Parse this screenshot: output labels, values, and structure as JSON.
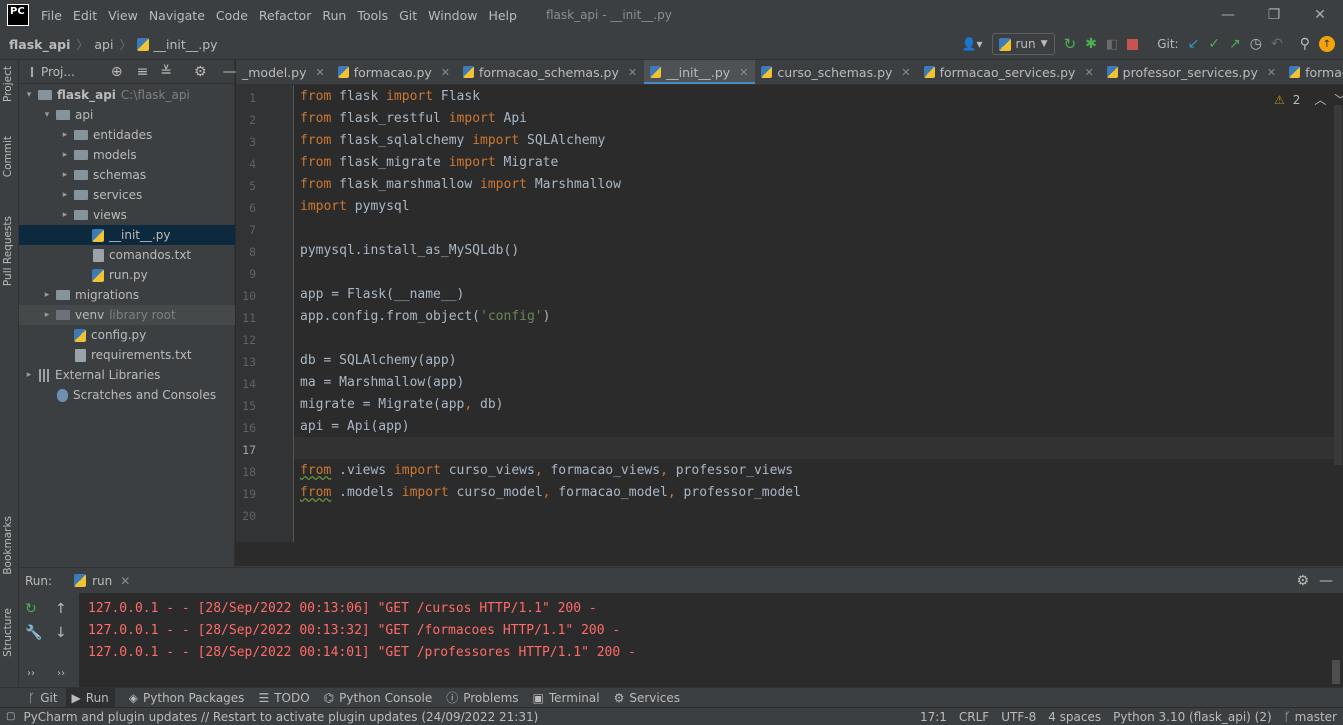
{
  "app": {
    "logo": "PC",
    "window_title": "flask_api - __init__.py",
    "menu": [
      "File",
      "Edit",
      "View",
      "Navigate",
      "Code",
      "Refactor",
      "Run",
      "Tools",
      "Git",
      "Window",
      "Help"
    ],
    "window_buttons": [
      "—",
      "❐",
      "✕"
    ]
  },
  "navbar": {
    "breadcrumb": [
      "flask_api",
      "api",
      "__init__.py"
    ],
    "run_config": "run",
    "git_label": "Git:"
  },
  "left_stripe": {
    "project": "Project",
    "commit": "Commit",
    "pull_requests": "Pull Requests",
    "bookmarks": "Bookmarks",
    "structure": "Structure"
  },
  "project_panel": {
    "title": "Proj...",
    "tree": [
      {
        "label": "flask_api",
        "extra": "C:\\flask_api",
        "type": "folder",
        "arrow": "▾"
      },
      {
        "label": "api",
        "type": "folder",
        "arrow": "▾"
      },
      {
        "label": "entidades",
        "type": "folder",
        "arrow": "▸"
      },
      {
        "label": "models",
        "type": "folder",
        "arrow": "▸"
      },
      {
        "label": "schemas",
        "type": "folder",
        "arrow": "▸"
      },
      {
        "label": "services",
        "type": "folder",
        "arrow": "▸"
      },
      {
        "label": "views",
        "type": "folder",
        "arrow": "▸"
      },
      {
        "label": "__init__.py",
        "type": "py",
        "arrow": ""
      },
      {
        "label": "comandos.txt",
        "type": "txt",
        "arrow": ""
      },
      {
        "label": "run.py",
        "type": "py",
        "arrow": ""
      },
      {
        "label": "migrations",
        "type": "folder",
        "arrow": "▸"
      },
      {
        "label": "venv",
        "extra": "library root",
        "type": "folder",
        "arrow": "▸"
      },
      {
        "label": "config.py",
        "type": "py",
        "arrow": ""
      },
      {
        "label": "requirements.txt",
        "type": "txt",
        "arrow": ""
      },
      {
        "label": "External Libraries",
        "type": "lib",
        "arrow": "▸"
      },
      {
        "label": "Scratches and Consoles",
        "type": "scratch",
        "arrow": ""
      }
    ]
  },
  "tabs": [
    "_model.py",
    "formacao.py",
    "formacao_schemas.py",
    "__init__.py",
    "curso_schemas.py",
    "formacao_services.py",
    "professor_services.py",
    "formacao_views"
  ],
  "editor": {
    "warning_count": "2",
    "line_numbers": [
      "1",
      "2",
      "3",
      "4",
      "5",
      "6",
      "7",
      "8",
      "9",
      "10",
      "11",
      "12",
      "13",
      "14",
      "15",
      "16",
      "17",
      "18",
      "19",
      "20"
    ],
    "lines": [
      "from flask import Flask",
      "from flask_restful import Api",
      "from flask_sqlalchemy import SQLAlchemy",
      "from flask_migrate import Migrate",
      "from flask_marshmallow import Marshmallow",
      "import pymysql",
      "",
      "pymysql.install_as_MySQLdb()",
      "",
      "app = Flask(__name__)",
      "app.config.from_object('config')",
      "",
      "db = SQLAlchemy(app)",
      "ma = Marshmallow(app)",
      "migrate = Migrate(app, db)",
      "api = Api(app)",
      "",
      "from .views import curso_views, formacao_views, professor_views",
      "from .models import curso_model, formacao_model, professor_model",
      ""
    ]
  },
  "run_panel": {
    "label": "Run:",
    "tab": "run",
    "log": [
      "127.0.0.1 - - [28/Sep/2022 00:13:06] \"GET /cursos HTTP/1.1\" 200 -",
      "127.0.0.1 - - [28/Sep/2022 00:13:32] \"GET /formacoes HTTP/1.1\" 200 -",
      "127.0.0.1 - - [28/Sep/2022 00:14:01] \"GET /professores HTTP/1.1\" 200 -"
    ]
  },
  "bottom_tools": [
    "Git",
    "Run",
    "Python Packages",
    "TODO",
    "Python Console",
    "Problems",
    "Terminal",
    "Services"
  ],
  "status": {
    "message": "PyCharm and plugin updates // Restart to activate plugin updates (24/09/2022 21:31)",
    "position": "17:1",
    "line_sep": "CRLF",
    "encoding": "UTF-8",
    "indent": "4 spaces",
    "interpreter": "Python 3.10 (flask_api) (2)",
    "branch": "master"
  }
}
